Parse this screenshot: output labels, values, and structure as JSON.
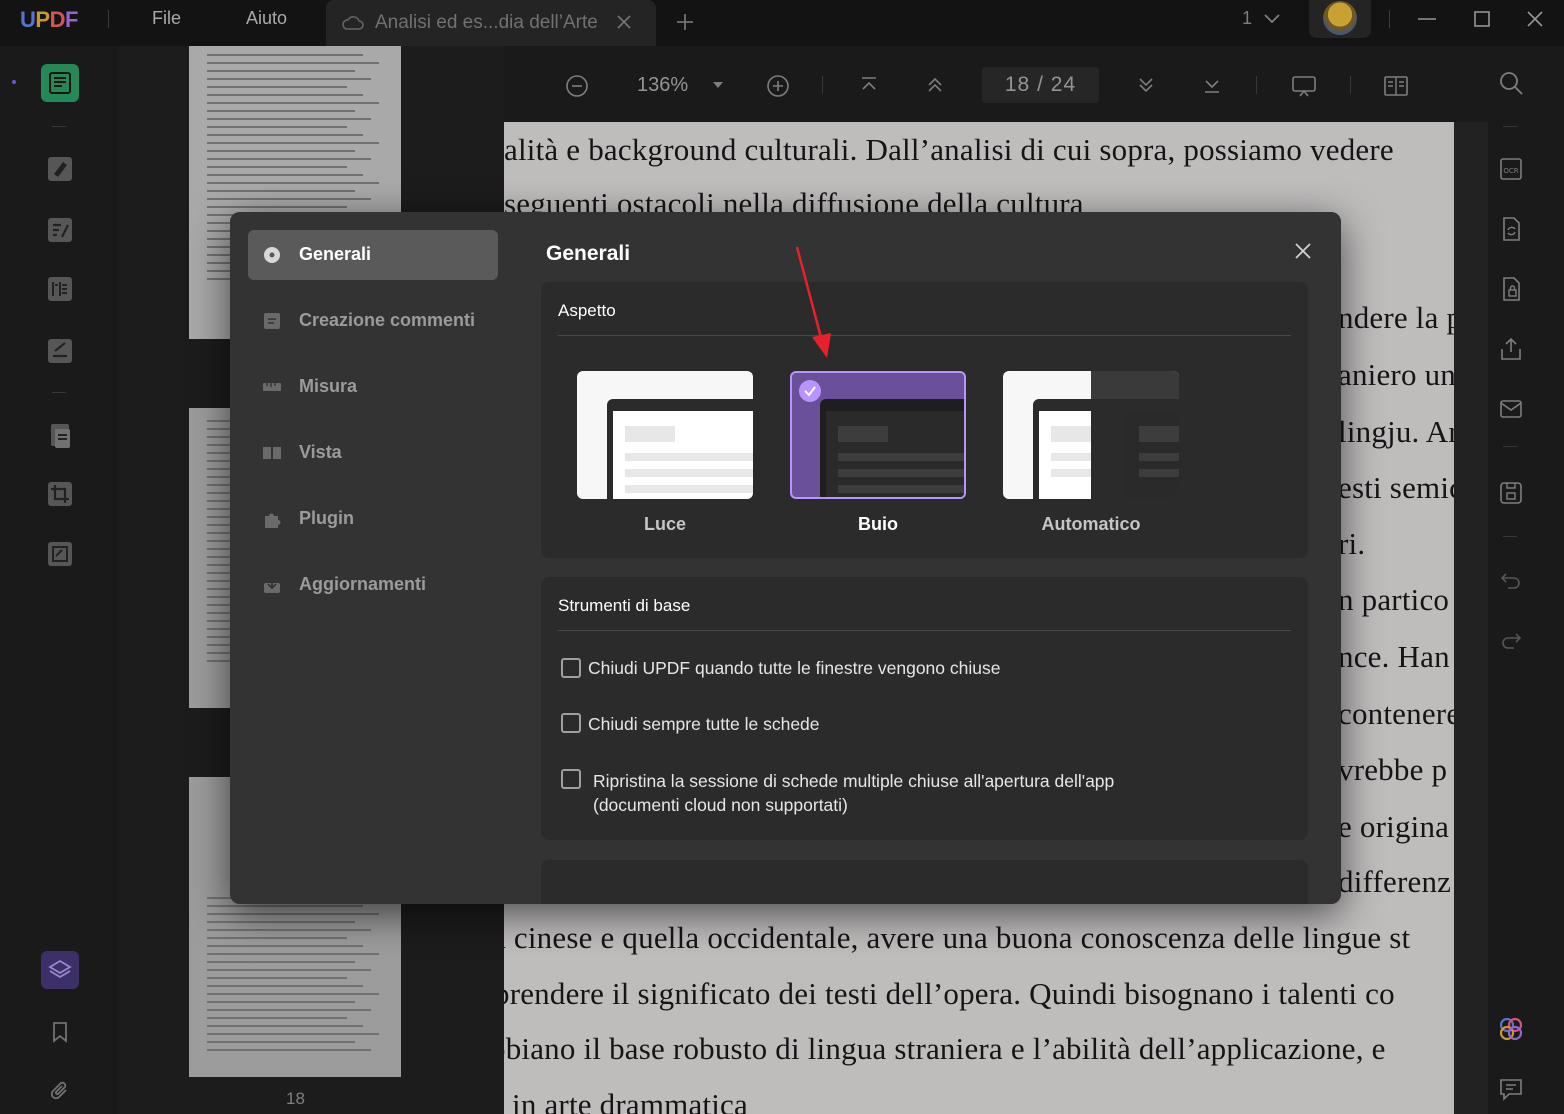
{
  "app": {
    "logo": {
      "u": "U",
      "p": "P",
      "d": "D",
      "f": "F"
    },
    "menu": {
      "file": "File",
      "help": "Aiuto"
    },
    "tab_title": "Analisi ed es...dia dell’Arte",
    "page_indicator": "1"
  },
  "viewer": {
    "zoom": "136%",
    "page_current": "18",
    "page_sep": "/",
    "page_total": "24",
    "thumb_page_number": "18"
  },
  "document_lines": [
    "alità e background culturali. Dall’analisi di cui sopra, possiamo vedere",
    "seguenti ostacoli nella diffusione della cultura",
    "ndere la p",
    "aniero un",
    "lingju. Ar",
    "esti semic",
    "ri.",
    "n partico",
    "nce.  Han",
    "contenere",
    "vrebbe p",
    "e origina",
    "differenz",
    "a cinese e quella occidentale, avere una buona conoscenza delle lingue st",
    "prendere il significato dei testi dell’opera. Quindi bisognano i talenti co",
    "obiano il base robusto di lingua straniera e l’abilità dell’applicazione, e",
    "in arte drammatica"
  ],
  "settings": {
    "nav": [
      {
        "label": "Generali",
        "icon": "general-icon"
      },
      {
        "label": "Creazione commenti",
        "icon": "comment-icon"
      },
      {
        "label": "Misura",
        "icon": "ruler-icon"
      },
      {
        "label": "Vista",
        "icon": "view-icon"
      },
      {
        "label": "Plugin",
        "icon": "puzzle-icon"
      },
      {
        "label": "Aggiornamenti",
        "icon": "download-icon"
      }
    ],
    "title": "Generali",
    "appearance": {
      "title": "Aspetto",
      "themes": [
        {
          "label": "Luce",
          "selected": false
        },
        {
          "label": "Buio",
          "selected": true
        },
        {
          "label": "Automatico",
          "selected": false
        }
      ]
    },
    "basic_tools": {
      "title": "Strumenti di base",
      "options": [
        {
          "label": "Chiudi UPDF quando tutte le finestre vengono chiuse",
          "checked": false
        },
        {
          "label": "Chiudi sempre tutte le schede",
          "checked": false
        },
        {
          "label": "Ripristina la sessione di schede multiple chiuse all'apertura dell'app",
          "label2": "(documenti cloud non supportati)",
          "checked": false
        }
      ]
    }
  },
  "colors": {
    "accent": "#b894ff",
    "active_tool": "#2fa66a",
    "annotation_arrow": "#e8202a"
  }
}
